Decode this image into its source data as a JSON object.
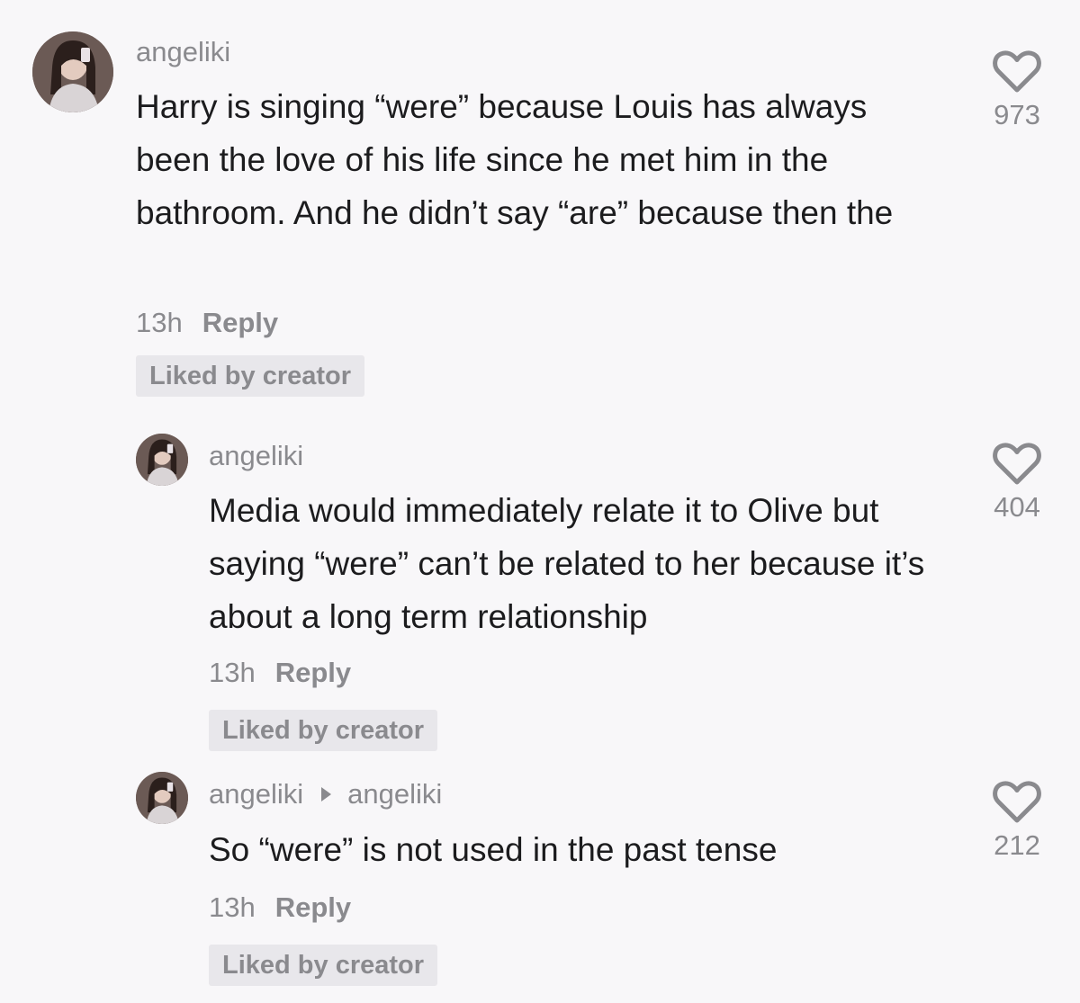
{
  "comments": [
    {
      "username": "angeliki",
      "text": "Harry is singing “were” because Louis has always been the love of his life since he met him in the bathroom. And he didn’t say “are” because then the",
      "time": "13h",
      "reply_label": "Reply",
      "badge": "Liked by creator",
      "likes": "973"
    },
    {
      "username": "angeliki",
      "text": "Media would immediately relate it to Olive but saying “were” can’t be related to her because it’s about a long term relationship",
      "time": "13h",
      "reply_label": "Reply",
      "badge": "Liked by creator",
      "likes": "404"
    },
    {
      "username": "angeliki",
      "reply_to": "angeliki",
      "text": "So “were” is not used in the past tense",
      "time": "13h",
      "reply_label": "Reply",
      "badge": "Liked by creator",
      "likes": "212"
    }
  ],
  "icons": {
    "heart": "heart-outline-icon",
    "reply_arrow": "reply-to-arrow-icon"
  },
  "colors": {
    "background": "#f8f7f9",
    "text": "#1c1c1e",
    "secondary": "#8a8a8e",
    "badge_bg": "#e8e7eb"
  }
}
